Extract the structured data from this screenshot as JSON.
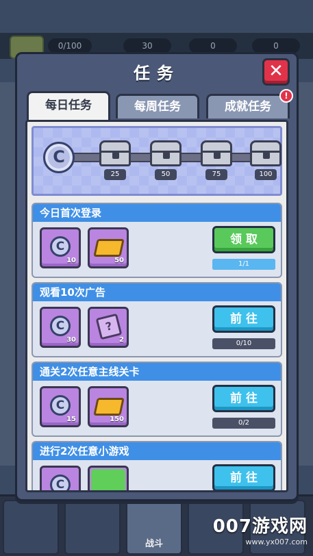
{
  "background": {
    "resources": [
      {
        "name": "energy",
        "value": "0/100"
      },
      {
        "name": "gems",
        "value": "30"
      },
      {
        "name": "gold",
        "value": "0"
      },
      {
        "name": "crystal",
        "value": "0"
      }
    ],
    "bottom_nav_active_label": "战斗",
    "watermark": {
      "big": "007游戏网",
      "small": "www.yx007.com"
    }
  },
  "modal": {
    "title": "任务",
    "tabs": [
      {
        "label": "每日任务",
        "active": true
      },
      {
        "label": "每周任务",
        "active": false
      },
      {
        "label": "成就任务",
        "active": false,
        "alert": "!"
      }
    ],
    "coin_symbol": "C",
    "milestones": [
      "25",
      "50",
      "75",
      "100"
    ],
    "tasks": [
      {
        "title": "今日首次登录",
        "rewards": [
          {
            "type": "coin",
            "symbol": "C",
            "count": "10"
          },
          {
            "type": "gold",
            "count": "50"
          }
        ],
        "button": "领取",
        "button_color": "green",
        "progress_text": "1/1",
        "progress_fraction": 1.0
      },
      {
        "title": "观看10次广告",
        "rewards": [
          {
            "type": "coin",
            "symbol": "C",
            "count": "30"
          },
          {
            "type": "ticket",
            "symbol": "?",
            "count": "2"
          }
        ],
        "button": "前往",
        "button_color": "blue",
        "progress_text": "0/10",
        "progress_fraction": 0.0
      },
      {
        "title": "通关2次任意主线关卡",
        "rewards": [
          {
            "type": "coin",
            "symbol": "C",
            "count": "15"
          },
          {
            "type": "gold",
            "count": "150"
          }
        ],
        "button": "前往",
        "button_color": "blue",
        "progress_text": "0/2",
        "progress_fraction": 0.0
      },
      {
        "title": "进行2次任意小游戏",
        "rewards": [
          {
            "type": "coin",
            "symbol": "C",
            "count": ""
          },
          {
            "type": "green",
            "count": ""
          }
        ],
        "button": "前往",
        "button_color": "blue",
        "progress_text": "",
        "progress_fraction": 0.0
      }
    ]
  }
}
